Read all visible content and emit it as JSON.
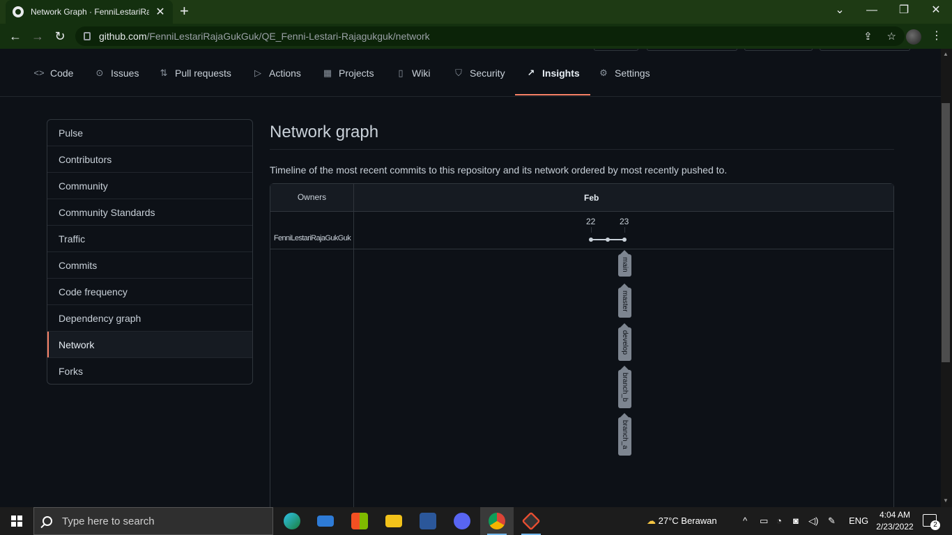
{
  "browser": {
    "tab_title": "Network Graph · FenniLestariRaja",
    "url_host": "github.com",
    "url_path": "/FenniLestariRajaGukGuk/QE_Fenni-Lestari-Rajagukguk/network"
  },
  "repo_nav": {
    "items": [
      {
        "label": "Code",
        "icon": "code-icon"
      },
      {
        "label": "Issues",
        "icon": "issue-icon"
      },
      {
        "label": "Pull requests",
        "icon": "pull-request-icon"
      },
      {
        "label": "Actions",
        "icon": "play-icon"
      },
      {
        "label": "Projects",
        "icon": "table-icon"
      },
      {
        "label": "Wiki",
        "icon": "book-icon"
      },
      {
        "label": "Security",
        "icon": "shield-icon"
      },
      {
        "label": "Insights",
        "icon": "graph-icon"
      },
      {
        "label": "Settings",
        "icon": "gear-icon"
      }
    ],
    "active": "Insights"
  },
  "sidebar": {
    "items": [
      "Pulse",
      "Contributors",
      "Community",
      "Community Standards",
      "Traffic",
      "Commits",
      "Code frequency",
      "Dependency graph",
      "Network",
      "Forks"
    ],
    "selected": "Network"
  },
  "main": {
    "title": "Network graph",
    "description": "Timeline of the most recent commits to this repository and its network ordered by most recently pushed to."
  },
  "network_graph": {
    "owners_header": "Owners",
    "month": "Feb",
    "days": [
      "22",
      "23"
    ],
    "owner": "FenniLestariRajaGukGuk",
    "branches": [
      "main",
      "master",
      "develop",
      "branch_b",
      "branch_a"
    ]
  },
  "taskbar": {
    "search_placeholder": "Type here to search",
    "weather": "27°C  Berawan",
    "language": "ENG",
    "time": "4:04 AM",
    "date": "2/23/2022",
    "notifications": "2"
  },
  "colors": {
    "accent_underline": "#f78166",
    "page_bg": "#0d1117",
    "browser_frame": "#14300f"
  }
}
